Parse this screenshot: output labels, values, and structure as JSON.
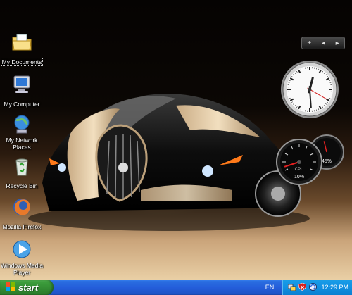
{
  "desktop": {
    "icons": [
      {
        "label": "My Documents",
        "icon": "folder-documents-icon"
      },
      {
        "label": "My Computer",
        "icon": "computer-icon"
      },
      {
        "label": "My Network Places",
        "icon": "network-places-icon"
      },
      {
        "label": "Recycle Bin",
        "icon": "recycle-bin-icon"
      },
      {
        "label": "Mozilla Firefox",
        "icon": "firefox-icon"
      },
      {
        "label": "Windows Media Player",
        "icon": "media-player-icon"
      }
    ]
  },
  "gadgets": {
    "controls": {
      "add": "+",
      "prev": "◂",
      "next": "▸"
    },
    "clock": {
      "hour": 12,
      "minute": 29,
      "second": 20
    },
    "cpu_meter": {
      "cpu_label": "CPU",
      "cpu_percent": "10%",
      "mem_percent": "45%",
      "cpu_value": 10,
      "mem_value": 45
    }
  },
  "taskbar": {
    "start_label": "start",
    "language": "EN",
    "time": "12:29 PM",
    "tray_icons": [
      "network-icon",
      "security-shield-icon",
      "update-icon"
    ]
  },
  "colors": {
    "taskbar_blue": "#245edb",
    "start_green": "#3c9c3c",
    "tray_blue": "#1190e2"
  }
}
